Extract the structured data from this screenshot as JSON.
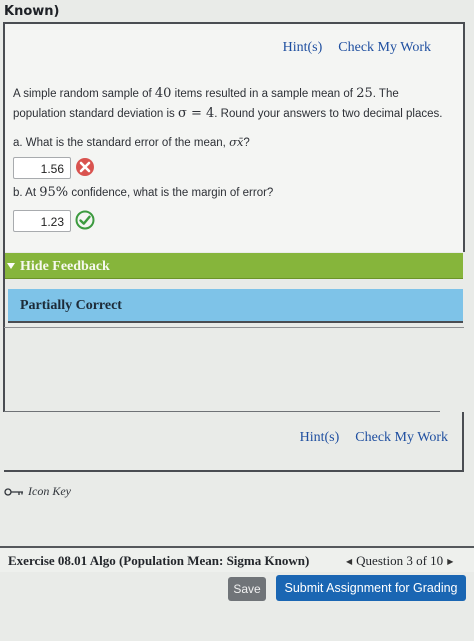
{
  "header": {
    "title": "Known)"
  },
  "links": {
    "hint": "Hint(s)",
    "check_work": "Check My Work"
  },
  "question": {
    "intro_1": "A simple random sample of ",
    "sample_size": "40",
    "intro_2": " items resulted in a sample mean of ",
    "sample_mean": "25",
    "intro_3": ". The population standard deviation is ",
    "sigma_symbol": "σ = 4",
    "intro_4": ". Round your answers to two decimal places.",
    "part_a": {
      "label": "a. What is the standard error of the mean, ",
      "symbol": "σx̄",
      "suffix": "?",
      "answer": "1.56",
      "status": "incorrect"
    },
    "part_b": {
      "label_1": "b. At ",
      "percent": "95%",
      "label_2": " confidence, what is the margin of error?",
      "answer": "1.23",
      "status": "correct"
    }
  },
  "feedback": {
    "toggle_label": "Hide Feedback",
    "result": "Partially Correct"
  },
  "icon_key": {
    "label": "Icon Key"
  },
  "footer": {
    "exercise_title": "Exercise 08.01 Algo (Population Mean: Sigma Known)",
    "question_position": "Question 3 of 10",
    "save_label": "Save",
    "submit_label": "Submit Assignment for Grading"
  },
  "colors": {
    "feedback_green": "#86b53b",
    "result_blue": "#7ec3e8",
    "incorrect_red": "#d9534f",
    "correct_green": "#3c9a3f",
    "submit_blue": "#1a66b3"
  }
}
